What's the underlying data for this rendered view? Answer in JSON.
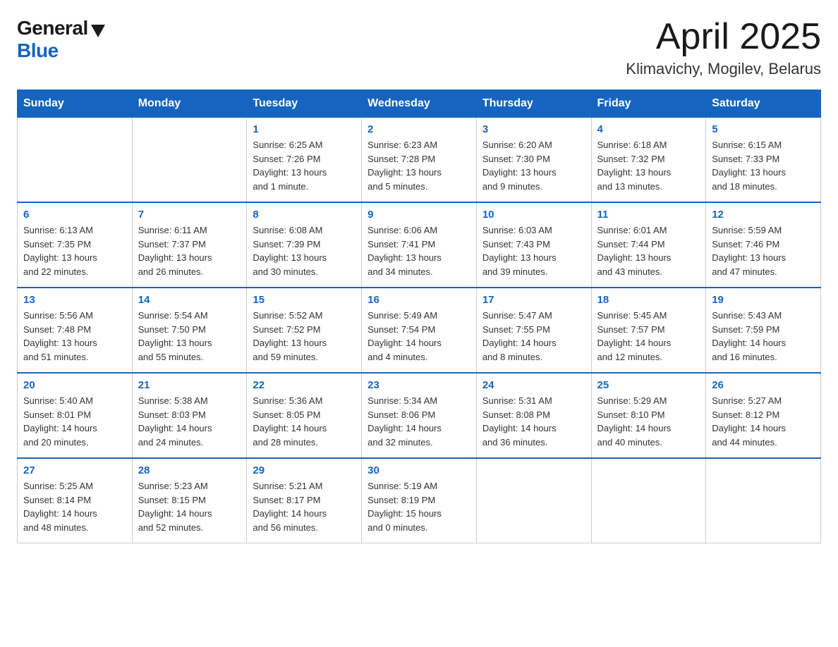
{
  "header": {
    "logo_general": "General",
    "logo_blue": "Blue",
    "month_title": "April 2025",
    "location": "Klimavichy, Mogilev, Belarus"
  },
  "weekdays": [
    "Sunday",
    "Monday",
    "Tuesday",
    "Wednesday",
    "Thursday",
    "Friday",
    "Saturday"
  ],
  "weeks": [
    [
      {
        "day": "",
        "info": ""
      },
      {
        "day": "",
        "info": ""
      },
      {
        "day": "1",
        "info": "Sunrise: 6:25 AM\nSunset: 7:26 PM\nDaylight: 13 hours\nand 1 minute."
      },
      {
        "day": "2",
        "info": "Sunrise: 6:23 AM\nSunset: 7:28 PM\nDaylight: 13 hours\nand 5 minutes."
      },
      {
        "day": "3",
        "info": "Sunrise: 6:20 AM\nSunset: 7:30 PM\nDaylight: 13 hours\nand 9 minutes."
      },
      {
        "day": "4",
        "info": "Sunrise: 6:18 AM\nSunset: 7:32 PM\nDaylight: 13 hours\nand 13 minutes."
      },
      {
        "day": "5",
        "info": "Sunrise: 6:15 AM\nSunset: 7:33 PM\nDaylight: 13 hours\nand 18 minutes."
      }
    ],
    [
      {
        "day": "6",
        "info": "Sunrise: 6:13 AM\nSunset: 7:35 PM\nDaylight: 13 hours\nand 22 minutes."
      },
      {
        "day": "7",
        "info": "Sunrise: 6:11 AM\nSunset: 7:37 PM\nDaylight: 13 hours\nand 26 minutes."
      },
      {
        "day": "8",
        "info": "Sunrise: 6:08 AM\nSunset: 7:39 PM\nDaylight: 13 hours\nand 30 minutes."
      },
      {
        "day": "9",
        "info": "Sunrise: 6:06 AM\nSunset: 7:41 PM\nDaylight: 13 hours\nand 34 minutes."
      },
      {
        "day": "10",
        "info": "Sunrise: 6:03 AM\nSunset: 7:43 PM\nDaylight: 13 hours\nand 39 minutes."
      },
      {
        "day": "11",
        "info": "Sunrise: 6:01 AM\nSunset: 7:44 PM\nDaylight: 13 hours\nand 43 minutes."
      },
      {
        "day": "12",
        "info": "Sunrise: 5:59 AM\nSunset: 7:46 PM\nDaylight: 13 hours\nand 47 minutes."
      }
    ],
    [
      {
        "day": "13",
        "info": "Sunrise: 5:56 AM\nSunset: 7:48 PM\nDaylight: 13 hours\nand 51 minutes."
      },
      {
        "day": "14",
        "info": "Sunrise: 5:54 AM\nSunset: 7:50 PM\nDaylight: 13 hours\nand 55 minutes."
      },
      {
        "day": "15",
        "info": "Sunrise: 5:52 AM\nSunset: 7:52 PM\nDaylight: 13 hours\nand 59 minutes."
      },
      {
        "day": "16",
        "info": "Sunrise: 5:49 AM\nSunset: 7:54 PM\nDaylight: 14 hours\nand 4 minutes."
      },
      {
        "day": "17",
        "info": "Sunrise: 5:47 AM\nSunset: 7:55 PM\nDaylight: 14 hours\nand 8 minutes."
      },
      {
        "day": "18",
        "info": "Sunrise: 5:45 AM\nSunset: 7:57 PM\nDaylight: 14 hours\nand 12 minutes."
      },
      {
        "day": "19",
        "info": "Sunrise: 5:43 AM\nSunset: 7:59 PM\nDaylight: 14 hours\nand 16 minutes."
      }
    ],
    [
      {
        "day": "20",
        "info": "Sunrise: 5:40 AM\nSunset: 8:01 PM\nDaylight: 14 hours\nand 20 minutes."
      },
      {
        "day": "21",
        "info": "Sunrise: 5:38 AM\nSunset: 8:03 PM\nDaylight: 14 hours\nand 24 minutes."
      },
      {
        "day": "22",
        "info": "Sunrise: 5:36 AM\nSunset: 8:05 PM\nDaylight: 14 hours\nand 28 minutes."
      },
      {
        "day": "23",
        "info": "Sunrise: 5:34 AM\nSunset: 8:06 PM\nDaylight: 14 hours\nand 32 minutes."
      },
      {
        "day": "24",
        "info": "Sunrise: 5:31 AM\nSunset: 8:08 PM\nDaylight: 14 hours\nand 36 minutes."
      },
      {
        "day": "25",
        "info": "Sunrise: 5:29 AM\nSunset: 8:10 PM\nDaylight: 14 hours\nand 40 minutes."
      },
      {
        "day": "26",
        "info": "Sunrise: 5:27 AM\nSunset: 8:12 PM\nDaylight: 14 hours\nand 44 minutes."
      }
    ],
    [
      {
        "day": "27",
        "info": "Sunrise: 5:25 AM\nSunset: 8:14 PM\nDaylight: 14 hours\nand 48 minutes."
      },
      {
        "day": "28",
        "info": "Sunrise: 5:23 AM\nSunset: 8:15 PM\nDaylight: 14 hours\nand 52 minutes."
      },
      {
        "day": "29",
        "info": "Sunrise: 5:21 AM\nSunset: 8:17 PM\nDaylight: 14 hours\nand 56 minutes."
      },
      {
        "day": "30",
        "info": "Sunrise: 5:19 AM\nSunset: 8:19 PM\nDaylight: 15 hours\nand 0 minutes."
      },
      {
        "day": "",
        "info": ""
      },
      {
        "day": "",
        "info": ""
      },
      {
        "day": "",
        "info": ""
      }
    ]
  ]
}
